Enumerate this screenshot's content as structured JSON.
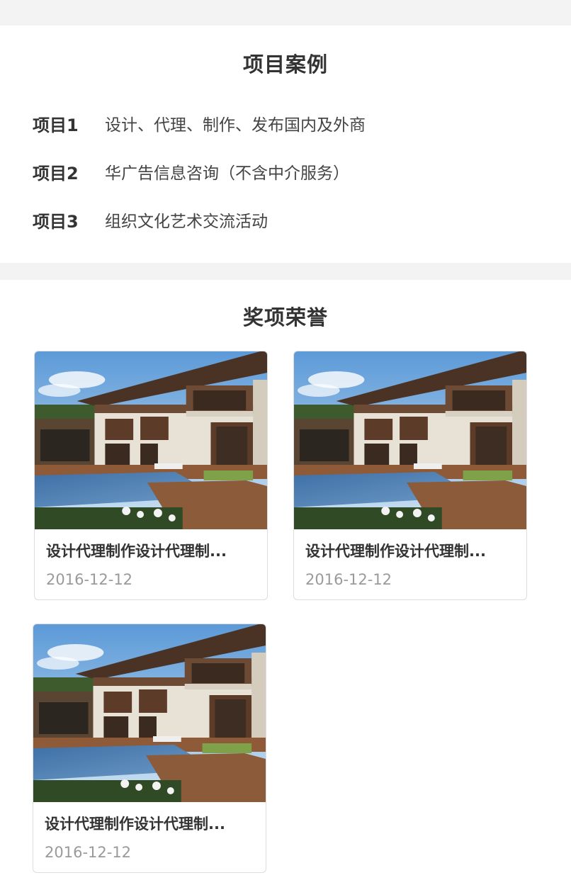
{
  "projects": {
    "title": "项目案例",
    "items": [
      {
        "label": "项目1",
        "text": "设计、代理、制作、发布国内及外商"
      },
      {
        "label": "项目2",
        "text": "华广告信息咨询（不含中介服务）"
      },
      {
        "label": "项目3",
        "text": "组织文化艺术交流活动"
      }
    ]
  },
  "awards": {
    "title": "奖项荣誉",
    "cards": [
      {
        "title": "设计代理制作设计代理制...",
        "date": "2016-12-12"
      },
      {
        "title": "设计代理制作设计代理制...",
        "date": "2016-12-12"
      },
      {
        "title": "设计代理制作设计代理制...",
        "date": "2016-12-12"
      }
    ]
  },
  "colors": {
    "gap": "#f3f3f3",
    "card_border": "#dddddd",
    "date_text": "#9a9a9a"
  }
}
